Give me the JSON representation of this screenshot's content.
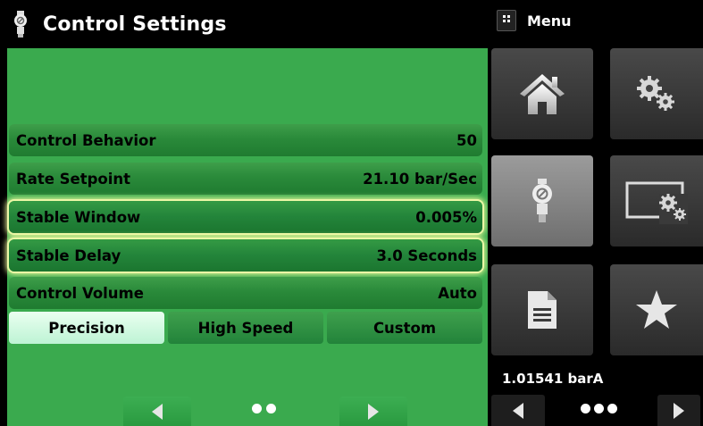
{
  "header": {
    "title": "Control Settings",
    "icon": "regulator-icon"
  },
  "settings": [
    {
      "label": "Control Behavior",
      "value": "50"
    },
    {
      "label": "Rate Setpoint",
      "value": "21.10 bar/Sec"
    },
    {
      "label": "Stable Window",
      "value": "0.005%"
    },
    {
      "label": "Stable Delay",
      "value": "3.0 Seconds"
    },
    {
      "label": "Control Volume",
      "value": "Auto"
    }
  ],
  "modes": [
    {
      "label": "Precision",
      "active": true
    },
    {
      "label": "High Speed",
      "active": false
    },
    {
      "label": "Custom",
      "active": false
    }
  ],
  "menu": {
    "label": "Menu"
  },
  "tiles": [
    "home-icon",
    "settings-gears-icon",
    "regulator-icon",
    "display-settings-icon",
    "document-icon",
    "favorites-star-icon"
  ],
  "readout": {
    "pressure": "1.01541 barA"
  },
  "colors": {
    "panel_green": "#3aaa4e",
    "selection_glow": "#f1fa9e",
    "tile_dark": "#3a3a3a",
    "tile_active": "#858585"
  }
}
